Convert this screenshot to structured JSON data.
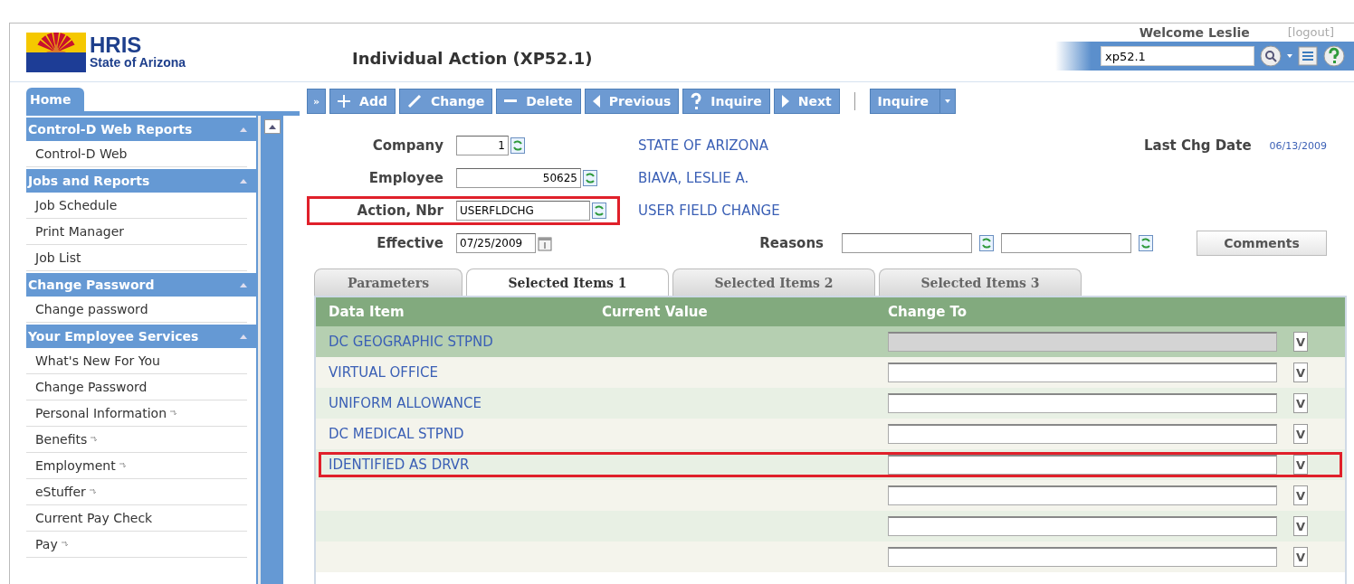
{
  "header": {
    "brand": "HRIS",
    "subtitle": "State of Arizona",
    "title": "Individual Action (XP52.1)",
    "welcome": "Welcome Leslie",
    "logout": "[logout]",
    "search": {
      "value": "xp52.1"
    }
  },
  "sidebar": {
    "home_tab": "Home",
    "sections": [
      {
        "title": "Control-D Web Reports",
        "expanded": true,
        "items": [
          {
            "label": "Control-D Web",
            "submenu": false
          }
        ]
      },
      {
        "title": "Jobs and Reports",
        "expanded": true,
        "items": [
          {
            "label": "Job Schedule",
            "submenu": false
          },
          {
            "label": "Print Manager",
            "submenu": false
          },
          {
            "label": "Job List",
            "submenu": false
          }
        ]
      },
      {
        "title": "Change Password",
        "expanded": true,
        "items": [
          {
            "label": "Change password",
            "submenu": false
          }
        ]
      },
      {
        "title": "Your Employee Services",
        "expanded": true,
        "items": [
          {
            "label": "What's New For You",
            "submenu": false
          },
          {
            "label": "Change Password",
            "submenu": false
          },
          {
            "label": "Personal Information",
            "submenu": true
          },
          {
            "label": "Benefits",
            "submenu": true
          },
          {
            "label": "Employment",
            "submenu": true
          },
          {
            "label": "eStuffer",
            "submenu": true
          },
          {
            "label": "Current Pay Check",
            "submenu": false
          },
          {
            "label": "Pay",
            "submenu": true
          }
        ]
      }
    ]
  },
  "toolbar": {
    "expand": "»",
    "buttons": [
      {
        "label": "Add",
        "kind": "plus"
      },
      {
        "label": "Change",
        "kind": "pencil"
      },
      {
        "label": "Delete",
        "kind": "minus"
      },
      {
        "label": "Previous",
        "kind": "left"
      },
      {
        "label": "Inquire",
        "kind": "question"
      },
      {
        "label": "Next",
        "kind": "right"
      }
    ],
    "menu_button": "Inquire"
  },
  "form": {
    "fields": [
      {
        "label": "Company",
        "value": "1",
        "kind": "number",
        "description": "STATE OF ARIZONA",
        "outlined": false
      },
      {
        "label": "Employee",
        "value": "50625",
        "kind": "number",
        "description": "BIAVA, LESLIE A.",
        "outlined": false
      },
      {
        "label": "Action, Nbr",
        "value": "USERFLDCHG",
        "kind": "code",
        "description": "USER FIELD CHANGE",
        "outlined": true
      },
      {
        "label": "Effective",
        "value": "07/25/2009",
        "kind": "date",
        "outlined": false
      }
    ],
    "last_change": {
      "label": "Last Chg Date",
      "value": "06/13/2009"
    },
    "reasons": {
      "label": "Reasons"
    },
    "comments_button": "Comments"
  },
  "tabs": [
    {
      "label": "Parameters",
      "selected": false
    },
    {
      "label": "Selected Items 1",
      "selected": true
    },
    {
      "label": "Selected Items 2",
      "selected": false
    },
    {
      "label": "Selected Items 3",
      "selected": false
    }
  ],
  "table": {
    "columns": [
      "Data Item",
      "Current Value",
      "Change To"
    ],
    "rows": [
      {
        "item": "DC GEOGRAPHIC STPND",
        "dropdown": "V",
        "selected": true,
        "disabled": true,
        "outlined": false
      },
      {
        "item": "VIRTUAL OFFICE",
        "dropdown": "V",
        "selected": false,
        "disabled": false,
        "outlined": false
      },
      {
        "item": "UNIFORM ALLOWANCE",
        "dropdown": "V",
        "selected": false,
        "disabled": false,
        "outlined": false
      },
      {
        "item": "DC MEDICAL STPND",
        "dropdown": "V",
        "selected": false,
        "disabled": false,
        "outlined": false
      },
      {
        "item": "IDENTIFIED AS DRVR",
        "dropdown": "V",
        "selected": false,
        "disabled": false,
        "outlined": true
      },
      {
        "dropdown": "V",
        "selected": false,
        "disabled": false,
        "outlined": false
      },
      {
        "dropdown": "V",
        "selected": false,
        "disabled": false,
        "outlined": false
      },
      {
        "dropdown": "V",
        "selected": false,
        "disabled": false,
        "outlined": false
      }
    ]
  }
}
